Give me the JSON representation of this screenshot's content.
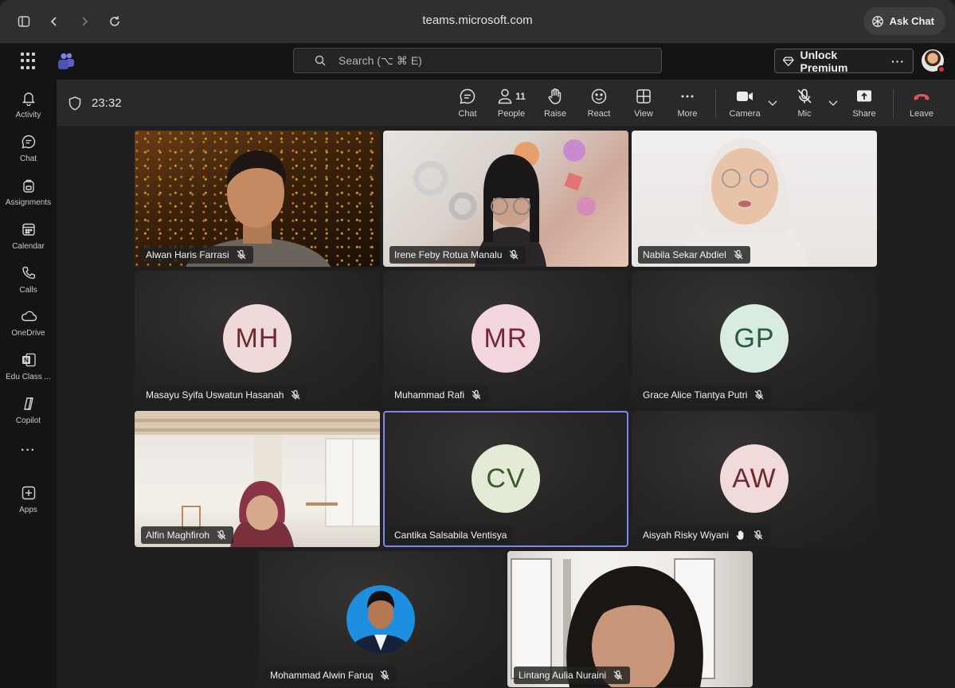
{
  "browser": {
    "url": "teams.microsoft.com",
    "ask_chat_label": "Ask Chat"
  },
  "topbar": {
    "search_placeholder": "Search (⌥ ⌘ E)",
    "premium_label": "Unlock Premium",
    "premium_more": "···"
  },
  "rail": {
    "items": [
      {
        "label": "Activity",
        "icon": "bell-icon"
      },
      {
        "label": "Chat",
        "icon": "chat-icon"
      },
      {
        "label": "Assignments",
        "icon": "backpack-icon"
      },
      {
        "label": "Calendar",
        "icon": "calendar-icon"
      },
      {
        "label": "Calls",
        "icon": "phone-icon"
      },
      {
        "label": "OneDrive",
        "icon": "cloud-icon"
      },
      {
        "label": "Edu Class ...",
        "icon": "onenote-icon"
      },
      {
        "label": "Copilot",
        "icon": "copilot-icon"
      },
      {
        "label": "Apps",
        "icon": "plus-square-icon"
      }
    ],
    "more": "···"
  },
  "meeting": {
    "timer": "23:32",
    "toolbar": {
      "chat": "Chat",
      "people": "People",
      "people_count": "11",
      "raise": "Raise",
      "react": "React",
      "view": "View",
      "more": "More",
      "camera": "Camera",
      "mic": "Mic",
      "share": "Share",
      "leave": "Leave"
    },
    "participants": [
      {
        "name": "Alwan Haris Farrasi",
        "video": true
      },
      {
        "name": "Irene Feby Rotua Manalu",
        "video": true
      },
      {
        "name": "Nabila Sekar Abdiel",
        "video": true
      },
      {
        "name": "Masayu Syifa Uswatun Hasanah",
        "initials": "MH",
        "avatar_bg": "#f0d9d9",
        "avatar_fg": "#6d2a2f"
      },
      {
        "name": "Muhammad Rafi",
        "initials": "MR",
        "avatar_bg": "#f3d6de",
        "avatar_fg": "#7a2638"
      },
      {
        "name": "Grace Alice Tiantya Putri",
        "initials": "GP",
        "avatar_bg": "#d9ece1",
        "avatar_fg": "#2b5a3c"
      },
      {
        "name": "Alfin Maghfiroh",
        "video": true
      },
      {
        "name": "Cantika Salsabila Ventisya",
        "initials": "CV",
        "avatar_bg": "#e3ebd6",
        "avatar_fg": "#3f5a2a",
        "speaking": true
      },
      {
        "name": "Aisyah Risky Wiyani",
        "initials": "AW",
        "avatar_bg": "#f1dada",
        "avatar_fg": "#6e2b31",
        "hand_raised": true
      },
      {
        "name": "Mohammad Alwin Faruq",
        "photo_avatar": true
      },
      {
        "name": "Lintang Aulia Nuraini",
        "video": true
      }
    ]
  }
}
